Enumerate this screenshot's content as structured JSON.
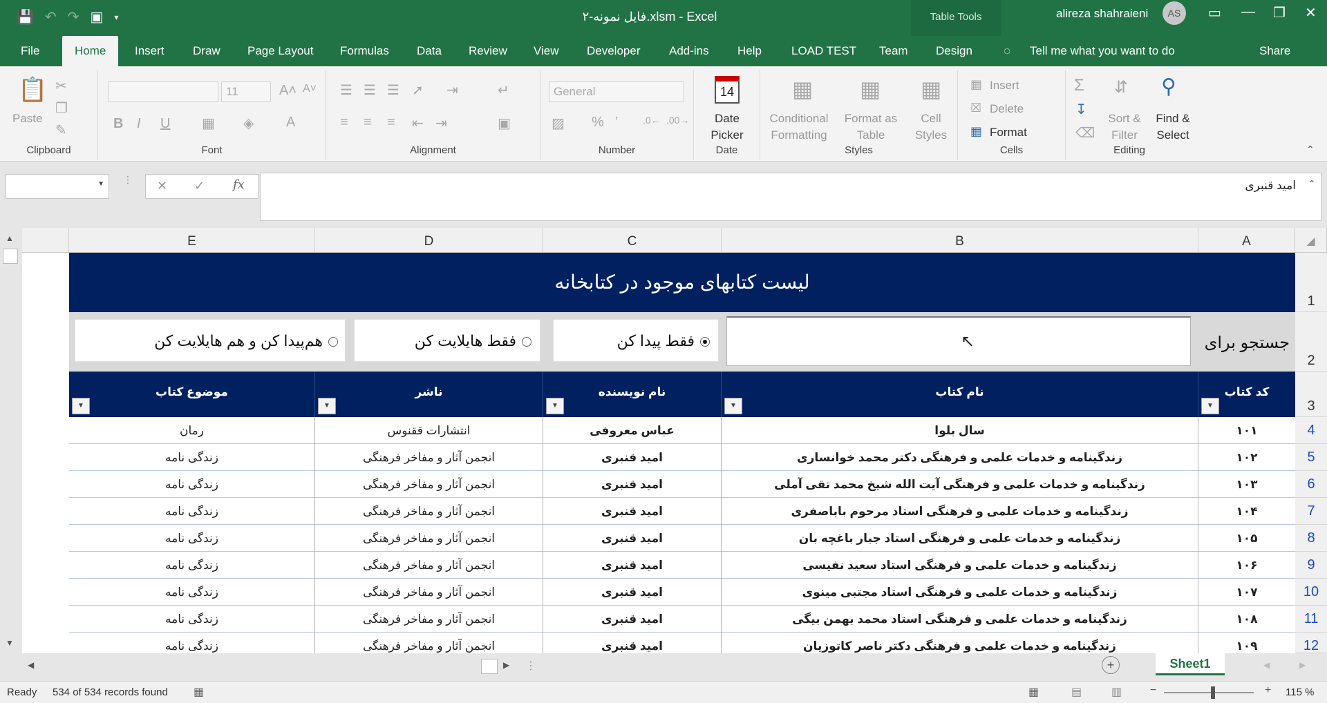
{
  "window": {
    "title": "فایل نمونه-۲.xlsm  -  Excel",
    "table_tools": "Table Tools",
    "user": "alireza shahraieni",
    "initials": "AS"
  },
  "tabs": [
    "File",
    "Home",
    "Insert",
    "Draw",
    "Page Layout",
    "Formulas",
    "Data",
    "Review",
    "View",
    "Developer",
    "Add-ins",
    "Help",
    "LOAD TEST",
    "Team",
    "Design"
  ],
  "tell_me": "Tell me what you want to do",
  "share": "Share",
  "ribbon": {
    "clipboard": {
      "label": "Clipboard",
      "paste": "Paste"
    },
    "font": {
      "label": "Font",
      "size": "11"
    },
    "alignment": {
      "label": "Alignment"
    },
    "number": {
      "label": "Number",
      "format": "General"
    },
    "date": {
      "label": "Date",
      "btn1": "Date",
      "btn2": "Picker",
      "icon_num": "14"
    },
    "styles": {
      "label": "Styles",
      "b1a": "Conditional",
      "b1b": "Formatting",
      "b2a": "Format as",
      "b2b": "Table",
      "b3a": "Cell",
      "b3b": "Styles"
    },
    "cells": {
      "label": "Cells",
      "insert": "Insert",
      "delete": "Delete",
      "format": "Format"
    },
    "editing": {
      "label": "Editing",
      "sort1": "Sort &",
      "sort2": "Filter",
      "find1": "Find &",
      "find2": "Select"
    }
  },
  "formula_bar": {
    "value": "امید قنبری"
  },
  "columns": [
    "A",
    "B",
    "C",
    "D",
    "E"
  ],
  "rows": [
    "1",
    "2",
    "3",
    "4",
    "5",
    "6",
    "7",
    "8",
    "9",
    "10",
    "11",
    "12"
  ],
  "sheet": {
    "title": "لیست کتابهای موجود در کتابخانه",
    "search_label": "جستجو برای",
    "options": [
      "فقط پیدا کن",
      "فقط هایلایت کن",
      "هم‌پیدا کن و هم هایلایت کن"
    ],
    "headers": [
      "کد کتاب",
      "نام کتاب",
      "نام نویسنده",
      "ناشر",
      "موضوع کتاب"
    ],
    "data": [
      [
        "۱۰۱",
        "سال بلوا",
        "عباس معروفی",
        "انتشارات ققنوس",
        "رمان"
      ],
      [
        "۱۰۲",
        "زندگینامه و خدمات علمی و فرهنگی دکتر محمد خوانساری",
        "امید قنبری",
        "انجمن آثار و مفاخر فرهنگی",
        "زندگی نامه"
      ],
      [
        "۱۰۳",
        "زندگینامه و خدمات علمی و فرهنگی آیت الله شیخ محمد تقی آملی",
        "امید قنبری",
        "انجمن آثار و مفاخر فرهنگی",
        "زندگی نامه"
      ],
      [
        "۱۰۴",
        "زندگینامه و خدمات علمی و فرهنگی استاد مرحوم باباصفری",
        "امید قنبری",
        "انجمن آثار و مفاخر فرهنگی",
        "زندگی نامه"
      ],
      [
        "۱۰۵",
        "زندگینامه و خدمات علمی و فرهنگی استاد جبار باغچه بان",
        "امید قنبری",
        "انجمن آثار و مفاخر فرهنگی",
        "زندگی نامه"
      ],
      [
        "۱۰۶",
        "زندگینامه و خدمات علمی و فرهنگی استاد سعید نفیسی",
        "امید قنبری",
        "انجمن آثار و مفاخر فرهنگی",
        "زندگی نامه"
      ],
      [
        "۱۰۷",
        "زندگینامه و خدمات علمی و فرهنگی استاد مجتبی مینوی",
        "امید قنبری",
        "انجمن آثار و مفاخر فرهنگی",
        "زندگی نامه"
      ],
      [
        "۱۰۸",
        "زندگینامه و خدمات علمی و فرهنگی استاد محمد بهمن بیگی",
        "امید قنبری",
        "انجمن آثار و مفاخر فرهنگی",
        "زندگی نامه"
      ],
      [
        "۱۰۹",
        "زندگینامه و خدمات علمی و فرهنگی دکتر ناصر کاتوزیان",
        "امید قنبری",
        "انجمن آثار و مفاخر فرهنگی",
        "زندگی نامه"
      ]
    ]
  },
  "sheet_tab": "Sheet1",
  "status": {
    "ready": "Ready",
    "records": "534 of 534 records found",
    "zoom": "115 %"
  }
}
